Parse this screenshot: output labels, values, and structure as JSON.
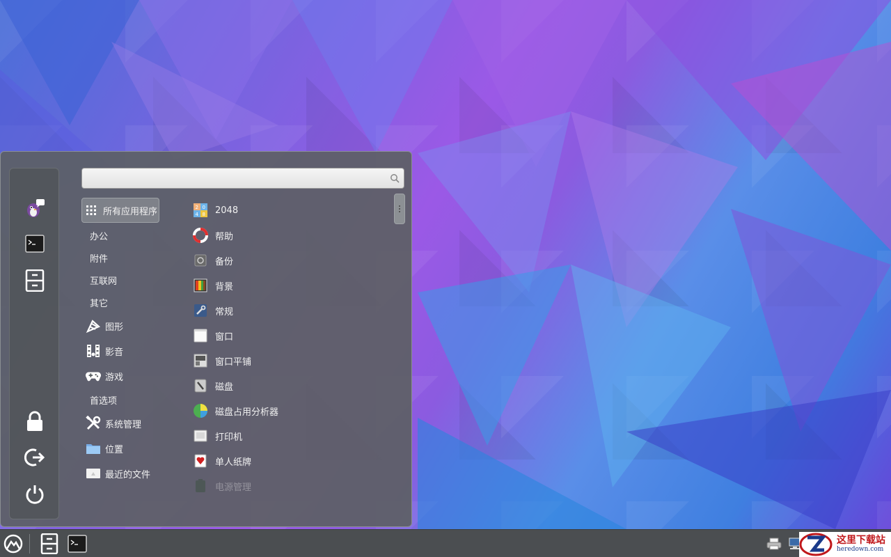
{
  "search": {
    "placeholder": "",
    "value": ""
  },
  "sidebar": {
    "favorites": [
      {
        "name": "pidgin-icon"
      },
      {
        "name": "terminal-icon"
      },
      {
        "name": "file-cabinet-icon"
      }
    ],
    "actions": [
      {
        "name": "lock-icon"
      },
      {
        "name": "logout-icon"
      },
      {
        "name": "power-icon"
      }
    ]
  },
  "categories": [
    {
      "label": "所有应用程序",
      "icon": "grid-icon",
      "selected": true
    },
    {
      "label": "办公",
      "icon": ""
    },
    {
      "label": "附件",
      "icon": ""
    },
    {
      "label": "互联网",
      "icon": ""
    },
    {
      "label": "其它",
      "icon": ""
    },
    {
      "label": "图形",
      "icon": "graphics-icon"
    },
    {
      "label": "影音",
      "icon": "film-icon"
    },
    {
      "label": "游戏",
      "icon": "gamepad-icon"
    },
    {
      "label": "首选项",
      "icon": ""
    },
    {
      "label": "系统管理",
      "icon": "tools-icon"
    },
    {
      "label": "位置",
      "icon": "folder-icon"
    },
    {
      "label": "最近的文件",
      "icon": "recent-files-icon"
    }
  ],
  "apps": [
    {
      "label": "2048",
      "icon": "game-2048-icon"
    },
    {
      "label": "帮助",
      "icon": "lifebuoy-icon"
    },
    {
      "label": "备份",
      "icon": "backup-icon"
    },
    {
      "label": "背景",
      "icon": "wallpaper-icon"
    },
    {
      "label": "常规",
      "icon": "settings-wrench-icon"
    },
    {
      "label": "窗口",
      "icon": "window-icon"
    },
    {
      "label": "窗口平铺",
      "icon": "window-tiling-icon"
    },
    {
      "label": "磁盘",
      "icon": "disk-icon"
    },
    {
      "label": "磁盘占用分析器",
      "icon": "disk-usage-icon"
    },
    {
      "label": "打印机",
      "icon": "printer-icon"
    },
    {
      "label": "单人纸牌",
      "icon": "solitaire-icon"
    },
    {
      "label": "电源管理",
      "icon": "power-management-icon",
      "faded": true
    }
  ],
  "taskbar": {
    "items": [
      "menu-icon",
      "file-cabinet-icon",
      "terminal-icon"
    ],
    "tray": [
      "printer-icon",
      "network-icon"
    ]
  },
  "watermark": {
    "title": "这里下载站",
    "subtitle": "heredown.com"
  },
  "colors": {
    "menu_bg": "#5c6064",
    "taskbar_bg": "#4b4e51",
    "desktop_accent": "#9b59e6"
  }
}
